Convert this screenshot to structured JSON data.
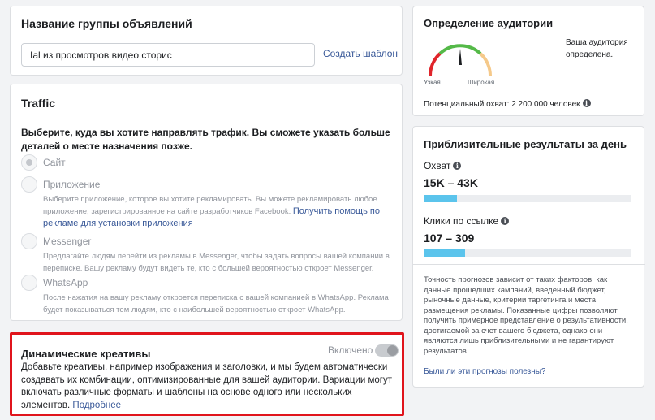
{
  "ad_group": {
    "title": "Название группы объявлений",
    "name_value": "Ial из просмотров видео сторис",
    "create_template_label": "Создать шаблон"
  },
  "traffic": {
    "title": "Traffic",
    "description": "Выберите, куда вы хотите направлять трафик. Вы сможете указать больше деталей о месте назначения позже.",
    "options": [
      {
        "label": "Сайт",
        "selected": true,
        "description": ""
      },
      {
        "label": "Приложение",
        "selected": false,
        "description": "Выберите приложение, которое вы хотите рекламировать. Вы можете рекламировать любое приложение, зарегистрированное на сайте разработчиков Facebook.",
        "link": "Получить помощь по рекламе для установки приложения"
      },
      {
        "label": "Messenger",
        "selected": false,
        "description": "Предлагайте людям перейти из рекламы в Messenger, чтобы задать вопросы вашей компании в переписке. Вашу рекламу будут видеть те, кто с большей вероятностью откроет Messenger."
      },
      {
        "label": "WhatsApp",
        "selected": false,
        "description": "После нажатия на вашу рекламу откроется переписка с вашей компанией в WhatsApp. Реклама будет показываться тем людям, кто с наибольшей вероятностью откроет WhatsApp."
      }
    ]
  },
  "dynamic_creative": {
    "title": "Динамические креативы",
    "toggle_label": "Включено",
    "toggle_on": true,
    "description": "Добавьте креативы, например изображения и заголовки, и мы будем автоматически создавать их комбинации, оптимизированные для вашей аудитории. Вариации могут включать различные форматы и шаблоны на основе одного или нескольких элементов.",
    "learn_more": "Подробнее"
  },
  "audience": {
    "title": "Определение аудитории",
    "gauge_left": "Узкая",
    "gauge_right": "Широкая",
    "gauge_level": 0.5,
    "status": "Ваша аудитория определена.",
    "reach_text": "Потенциальный охват: 2 200 000 человек",
    "colors": {
      "narrow": "#e0252b",
      "good": "#54b948",
      "broad": "#f5c98a",
      "needle": "#1c1e21"
    }
  },
  "results": {
    "title": "Приблизительные результаты за день",
    "metrics": [
      {
        "label": "Охват",
        "value": "15K – 43K",
        "fill": 0.16
      },
      {
        "label": "Клики по ссылке",
        "value": "107 – 309",
        "fill": 0.2
      }
    ],
    "note": "Точность прогнозов зависит от таких факторов, как данные прошедших кампаний, введенный бюджет, рыночные данные, критерии таргетинга и места размещения рекламы. Показанные цифры позволяют получить примерное представление о результативности, достигаемой за счет вашего бюджета, однако они являются лишь приблизительными и не гарантируют результатов.",
    "helpful_link": "Были ли эти прогнозы полезны?",
    "bar_color": "#5bc4ec"
  },
  "icons": {
    "info": "info-icon"
  }
}
